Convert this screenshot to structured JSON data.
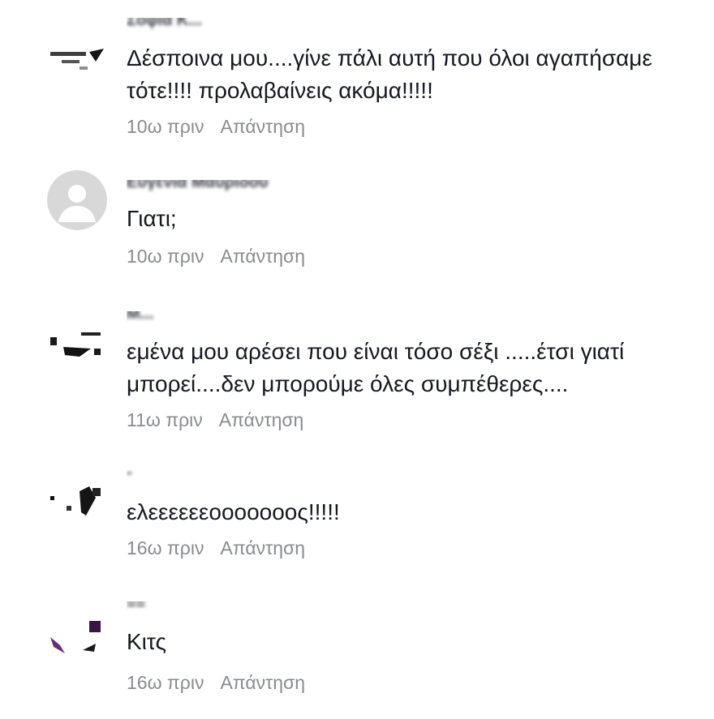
{
  "comments": [
    {
      "username": "Σοφια Κ...",
      "text": "Δέσποινα μου....γίνε πάλι αυτή που όλοι αγαπήσαμε\nτότε!!!! προλαβαίνεις ακόμα!!!!!",
      "time": "10ω πριν",
      "reply": "Απάντηση"
    },
    {
      "username": "Ευγενια Μαυρίδου",
      "text": "Γιατι;",
      "time": "10ω πριν",
      "reply": "Απάντηση"
    },
    {
      "username": "Μ...",
      "text": "εμένα μου αρέσει που είναι τόσο σέξι .....έτσι γιατί\nμπορεί....δεν μπορούμε όλες συμπέθερες....",
      "time": "11ω πριν",
      "reply": "Απάντηση"
    },
    {
      "username": "-",
      "text": "ελεεεεεεοοοοοοος!!!!!",
      "time": "16ω πριν",
      "reply": "Απάντηση"
    },
    {
      "username": "==",
      "text": "Κιτς",
      "time": "16ω πριν",
      "reply": "Απάντηση"
    }
  ],
  "icons": {
    "avatar_default": "default-user-avatar-icon"
  },
  "colors": {
    "text": "#161823",
    "meta": "#8a8b91",
    "default_avatar_bg": "#d8d8d8"
  }
}
